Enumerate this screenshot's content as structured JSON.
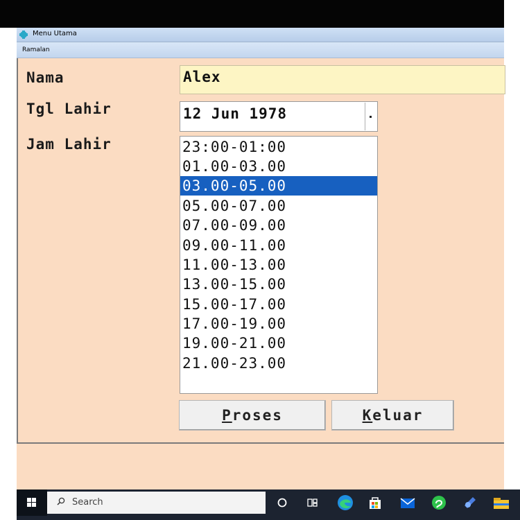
{
  "window": {
    "title": "Menu Utama",
    "subtitle": "Ramalan"
  },
  "form": {
    "nama_label": "Nama",
    "nama_value": "Alex",
    "tgl_label": "Tgl Lahir",
    "tgl_value": "12 Jun 1978",
    "jam_label": "Jam Lahir",
    "jam_options": [
      "23:00-01:00",
      "01.00-03.00",
      "03.00-05.00",
      "05.00-07.00",
      "07.00-09.00",
      "09.00-11.00",
      "11.00-13.00",
      "13.00-15.00",
      "15.00-17.00",
      "17.00-19.00",
      "19.00-21.00",
      "21.00-23.00"
    ],
    "selected_index": 2
  },
  "buttons": {
    "proses_first": "P",
    "proses_rest": "roses",
    "keluar_first": "K",
    "keluar_rest": "eluar"
  },
  "taskbar": {
    "search_placeholder": "Search"
  },
  "colors": {
    "form_background": "#fbdcc2",
    "name_field": "#fdf5c4",
    "selection": "#1760c0",
    "taskbar": "#1c2330"
  },
  "icons": [
    "windows-start-icon",
    "search-icon",
    "cortana-icon",
    "task-view-icon",
    "edge-icon",
    "store-icon",
    "mail-icon",
    "app-icon",
    "app-icon",
    "file-explorer-icon"
  ]
}
